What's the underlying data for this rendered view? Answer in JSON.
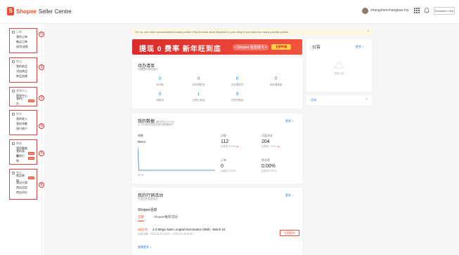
{
  "header": {
    "logo_text": "Shopee",
    "logo_sub": "Seller Centre",
    "username": "zhangzhenchangbao.my",
    "edu_label": "Education Hub"
  },
  "sidebar": {
    "groups": [
      {
        "title": "订单",
        "items": [
          {
            "label": "我的订单"
          },
          {
            "label": "集运订单"
          },
          {
            "label": "退货/退款"
          }
        ],
        "marker": "①"
      },
      {
        "title": "商品",
        "items": [
          {
            "label": "我的商品"
          },
          {
            "label": "添加商品"
          },
          {
            "label": "商品违规"
          }
        ],
        "marker": "②"
      },
      {
        "title": "营销中心",
        "items": [
          {
            "label": "营销中心"
          },
          {
            "label": "我的广告",
            "badge": "NEW"
          }
        ],
        "marker": "③"
      },
      {
        "title": "财务",
        "items": [
          {
            "label": "我的收入"
          },
          {
            "label": "我的余额"
          },
          {
            "label": "银行账户"
          }
        ],
        "marker": "④"
      },
      {
        "title": "数据",
        "items": [
          {
            "label": "我的数据"
          },
          {
            "label": "我的表现",
            "badge": "NEW"
          },
          {
            "label": "我的行销",
            "badge": "NEW"
          }
        ],
        "marker": "⑤"
      },
      {
        "title": "商店",
        "items": [
          {
            "label": "商店装修",
            "badge": "NEW"
          },
          {
            "label": "商店分类"
          },
          {
            "label": "商店设定"
          },
          {
            "label": "商店评价"
          }
        ],
        "marker": "⑥"
      }
    ]
  },
  "alert": {
    "text": "Oh no, you have accumulated penalty points! Click to learn what happens to your shop if you have too many penalty points!",
    "close": "×"
  },
  "banner": {
    "text": "提现 0 费率  新年旺到底",
    "tag": "• Shopee 连连钱卡 •",
    "button": "立即申请"
  },
  "todo": {
    "title": "待办清单",
    "subtitle": "你需要处理的事项",
    "items": [
      {
        "value": "0",
        "label": "未付款"
      },
      {
        "value": "0",
        "label": "待处理发货"
      },
      {
        "value": "0",
        "label": "已处理发货"
      },
      {
        "value": "0",
        "label": "待处理退款"
      },
      {
        "value": "0",
        "label": "待取消"
      },
      {
        "value": "1",
        "label": "已禁止商品"
      },
      {
        "value": "0",
        "label": "已售完商品"
      }
    ]
  },
  "announcement": {
    "title": "公告",
    "more": "更多 >",
    "empty": "没有公告",
    "footer_link": "活动",
    "footer_more": ">"
  },
  "performance": {
    "title": "我的数据",
    "title_note": "(截至昨日 23:00)",
    "subtitle": "以下为您的商店的各项数据概况",
    "more": "更多 >",
    "sales_label": "销售",
    "sales_value": "RM 0",
    "chart_left_label": "00:00",
    "metrics": [
      {
        "label": "访客",
        "value": "112",
        "change_label": "比前天",
        "change": "4.00%"
      },
      {
        "label": "页面浏览",
        "value": "204",
        "change_label": "比前天",
        "change": "7.37%"
      },
      {
        "label": "订单",
        "value": "0",
        "change_label": "比前天",
        "change": "0.00%"
      },
      {
        "label": "转化率",
        "value": "0.00%",
        "change_label": "比前天",
        "change": "0.00%"
      }
    ]
  },
  "marketing": {
    "title": "我的行销活动",
    "subtitle": "可参加的促销活动",
    "more": "更多 >",
    "section": "Shopee活动",
    "tabs": [
      {
        "label": "全部"
      },
      {
        "label": "Shopee推荐活动"
      }
    ],
    "activity": {
      "tag": "[报名中]",
      "title": "3.3 Mega Sale Longtail Nomination (MM) - Batch 16",
      "meta": "活动日期：2022-02-22 00:00 — 2022-03-04 23:59",
      "button": "立即报名"
    },
    "view_more": "查看更多 >"
  }
}
